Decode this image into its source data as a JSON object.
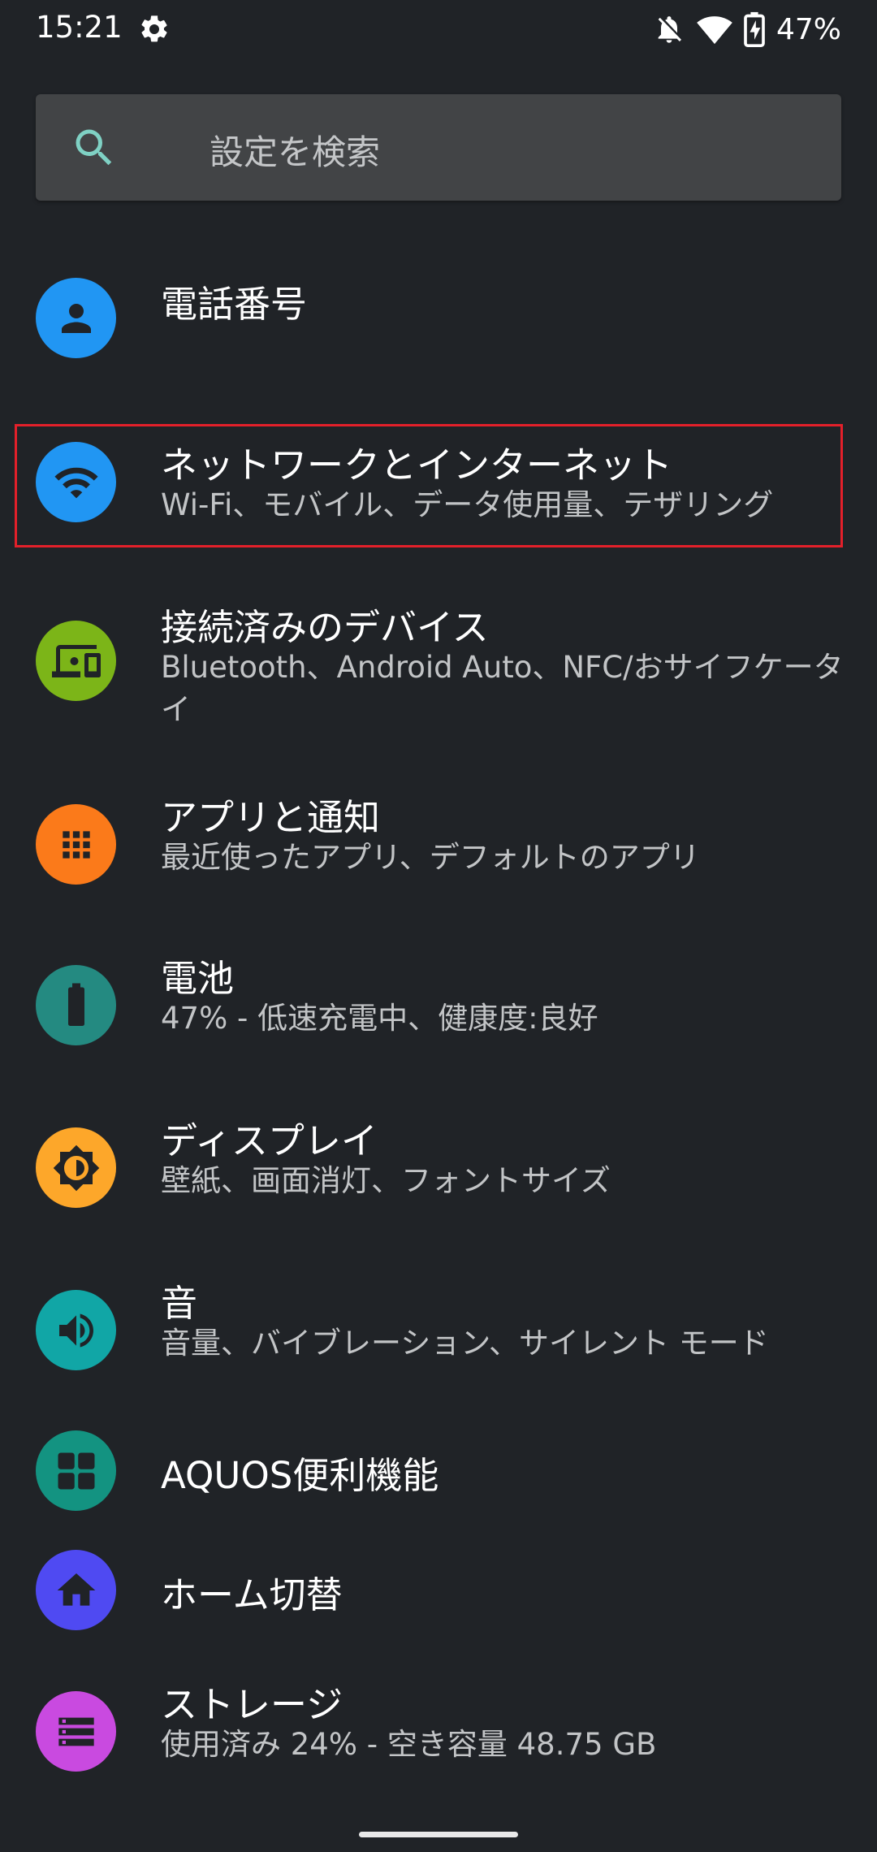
{
  "status_bar": {
    "time": "15:21",
    "battery_percent": "47%",
    "icons": [
      "gear-icon",
      "notifications-off-icon",
      "wifi-icon",
      "battery-charging-icon"
    ]
  },
  "search": {
    "placeholder": "設定を検索"
  },
  "items": [
    {
      "title": "電話番号",
      "subtitle": "",
      "icon": "person-icon",
      "color": "#2196f3"
    },
    {
      "title": "ネットワークとインターネット",
      "subtitle": "Wi-Fi、モバイル、データ使用量、テザリング",
      "icon": "wifi-icon",
      "color": "#2196f3"
    },
    {
      "title": "接続済みのデバイス",
      "subtitle": "Bluetooth、Android Auto、NFC/おサイフケータイ",
      "icon": "devices-icon",
      "color": "#7cb518"
    },
    {
      "title": "アプリと通知",
      "subtitle": "最近使ったアプリ、デフォルトのアプリ",
      "icon": "apps-icon",
      "color": "#fb7a1a"
    },
    {
      "title": "電池",
      "subtitle": "47% - 低速充電中、健康度:良好",
      "icon": "battery-icon",
      "color": "#248a81"
    },
    {
      "title": "ディスプレイ",
      "subtitle": "壁紙、画面消灯、フォントサイズ",
      "icon": "brightness-icon",
      "color": "#fda72a"
    },
    {
      "title": "音",
      "subtitle": "音量、バイブレーション、サイレント モード",
      "icon": "volume-icon",
      "color": "#11a6a6"
    },
    {
      "title": "AQUOS便利機能",
      "subtitle": "",
      "icon": "grid-icon",
      "color": "#139381"
    },
    {
      "title": "ホーム切替",
      "subtitle": "",
      "icon": "home-icon",
      "color": "#4f4af2"
    },
    {
      "title": "ストレージ",
      "subtitle": "使用済み 24% - 空き容量 48.75 GB",
      "icon": "storage-icon",
      "color": "#c94ae0"
    }
  ],
  "highlighted_item": "ネットワークとインターネット",
  "highlight_color": "#e3202a"
}
